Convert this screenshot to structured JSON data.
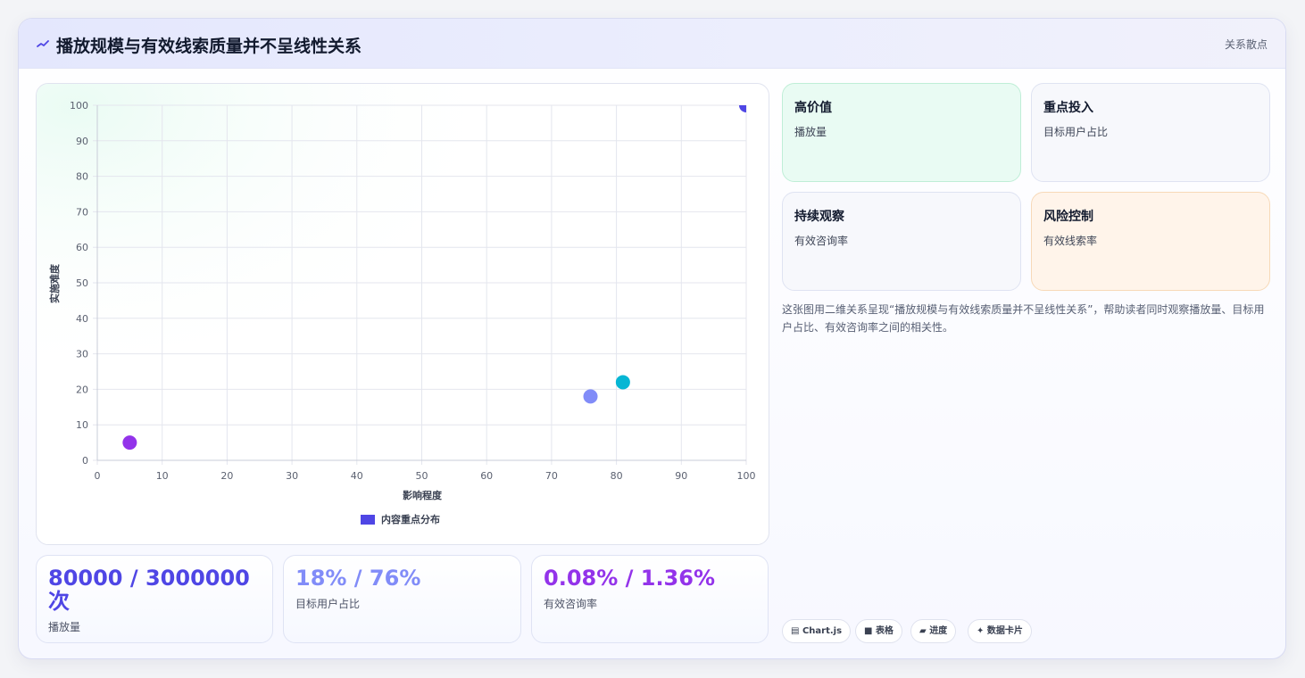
{
  "header": {
    "title": "播放规模与有效线索质量并不呈线性关系",
    "tag": "关系散点"
  },
  "colors": {
    "accent": "#4f46e5",
    "stat_value_1": "#4f46e5",
    "stat_value_2": "#818cf8",
    "stat_value_3": "#9333ea",
    "tile_green_bg": "#e9fbf3",
    "tile_orange_bg": "#fff4ea"
  },
  "chart_data": {
    "type": "scatter",
    "xlabel": "影响程度",
    "ylabel": "实施难度",
    "xlim": [
      0,
      100
    ],
    "ylim": [
      0,
      100
    ],
    "xticks": [
      "0",
      "10",
      "20",
      "30",
      "40",
      "50",
      "60",
      "70",
      "80",
      "90",
      "100"
    ],
    "yticks": [
      "0",
      "10",
      "20",
      "30",
      "40",
      "50",
      "60",
      "70",
      "80",
      "90",
      "100"
    ],
    "grid": true,
    "legend_position": "bottom",
    "series": [
      {
        "name": "内容重点分布",
        "color": "#4f46e5",
        "points": [
          {
            "x": 100,
            "y": 100,
            "color": "#4f46e5"
          },
          {
            "x": 76,
            "y": 18,
            "color": "#818cf8"
          },
          {
            "x": 81,
            "y": 22,
            "color": "#06b6d4"
          },
          {
            "x": 5,
            "y": 5,
            "color": "#9333ea"
          }
        ]
      }
    ]
  },
  "stats": [
    {
      "value": "80000 / 3000000 次",
      "label": "播放量"
    },
    {
      "value": "18% / 76%",
      "label": "目标用户占比"
    },
    {
      "value": "0.08% / 1.36%",
      "label": "有效咨询率"
    }
  ],
  "tiles": [
    {
      "title": "高价值",
      "sub": "播放量"
    },
    {
      "title": "重点投入",
      "sub": "目标用户占比"
    },
    {
      "title": "持续观察",
      "sub": "有效咨询率"
    },
    {
      "title": "风险控制",
      "sub": "有效线索率"
    }
  ],
  "description": "这张图用二维关系呈现“播放规模与有效线索质量并不呈线性关系”，帮助读者同时观察播放量、目标用户占比、有效咨询率之间的相关性。",
  "chips": [
    {
      "icon": "chart-icon",
      "glyph": "▤",
      "label": "Chart.js"
    },
    {
      "icon": "table-icon",
      "glyph": "■",
      "label": "表格"
    },
    {
      "icon": "progress-icon",
      "glyph": "▰",
      "label": "进度"
    },
    {
      "icon": "datacard-icon",
      "glyph": "✦",
      "label": "数据卡片"
    }
  ]
}
